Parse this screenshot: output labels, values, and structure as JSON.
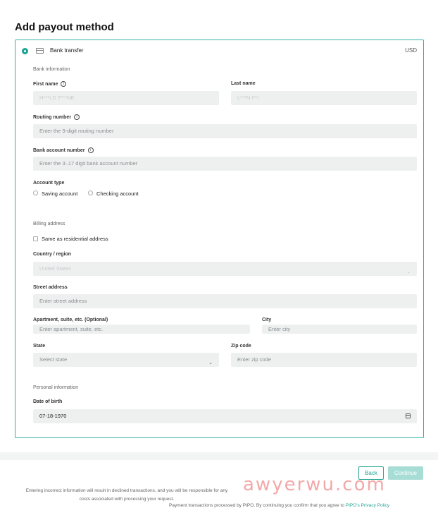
{
  "page_title": "Add payout method",
  "method": {
    "label": "Bank transfer",
    "currency": "USD"
  },
  "bank_info": {
    "section_title": "Bank information",
    "first_name_label": "First name",
    "first_name_value": "H***LD T***NE",
    "last_name_label": "Last name",
    "last_name_value": "L***N I**I",
    "routing_label": "Routing number",
    "routing_placeholder": "Enter the 9-digit routing number",
    "account_label": "Bank account number",
    "account_placeholder": "Enter the 3–17 digit bank account number",
    "account_type_label": "Account type",
    "saving_label": "Saving account",
    "checking_label": "Checking account"
  },
  "billing": {
    "section_title": "Billing address",
    "same_as_label": "Same as residential address",
    "country_label": "Country / region",
    "country_value": "United States",
    "street_label": "Street address",
    "street_placeholder": "Enter street address",
    "apt_label": "Apartment, suite, etc. (Optional)",
    "apt_placeholder": "Enter apartment, suite, etc.",
    "city_label": "City",
    "city_placeholder": "Enter city",
    "state_label": "State",
    "state_placeholder": "Select state",
    "zip_label": "Zip code",
    "zip_placeholder": "Enter zip code"
  },
  "personal": {
    "section_title": "Personal information",
    "dob_label": "Date of birth",
    "dob_value": "07-18-1970"
  },
  "actions": {
    "back_label": "Back",
    "continue_label": "Continue"
  },
  "footer": {
    "note": "Entering incorrect information will result in declined transactions, and you will be responsible for any costs associated with processing your request.",
    "legal_text": "Payment transactions processed by PIPO. By continuing you confirm that you agree to ",
    "legal_link": "PIPO's Privacy Policy"
  },
  "watermark": "awyerwu.com",
  "colors": {
    "accent": "#26a595",
    "field_bg": "#eef0f0",
    "continue_disabled": "#a8ddd6"
  },
  "icons": [
    "bank-card-icon",
    "info-icon",
    "chevron-down-icon",
    "calendar-icon"
  ]
}
